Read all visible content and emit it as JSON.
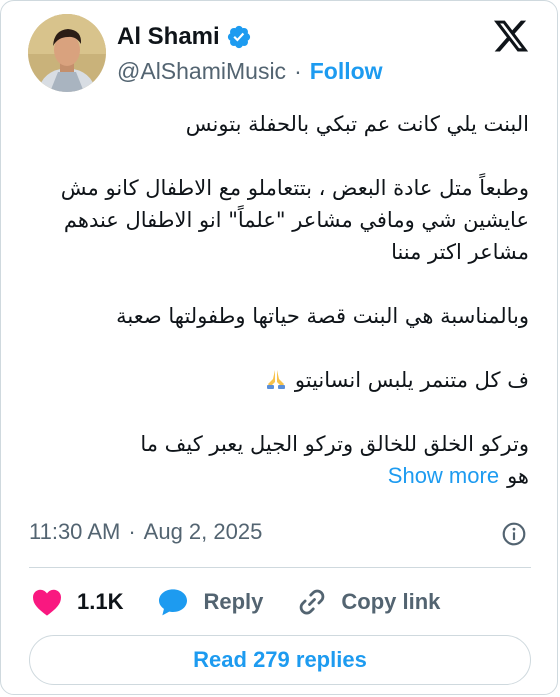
{
  "author": {
    "name": "Al Shami",
    "handle": "@AlShamiMusic",
    "separator": "·",
    "follow_label": "Follow",
    "verified_icon": "verified-badge-icon"
  },
  "platform_icon": "x-logo-icon",
  "tweet": {
    "paragraphs": [
      "البنت يلي كانت عم تبكي بالحفلة بتونس",
      "وطبعاً متل عادة البعض ، بتتعاملو مع الاطفال كانو مش عايشين شي ومافي مشاعر \"علماً\" انو الاطفال عندهم مشاعر اكتر مننا",
      "وبالمناسبة هي البنت قصة حياتها وطفولتها صعبة",
      "ف كل متنمر يلبس انسانيتو",
      "وتركو الخلق للخالق وتركو الجيل يعبر كيف ما"
    ],
    "last_fragment": "هو",
    "show_more_label": "Show more",
    "emoji": "folded-hands-icon"
  },
  "meta": {
    "time": "11:30 AM",
    "separator": "·",
    "date": "Aug 2, 2025"
  },
  "actions": {
    "like_count": "1.1K",
    "reply_label": "Reply",
    "copy_link_label": "Copy link"
  },
  "read_replies_label": "Read 279 replies",
  "colors": {
    "accent": "#1d9bf0",
    "like": "#f91880",
    "secondary_text": "#536471",
    "border": "#cfd9de"
  }
}
